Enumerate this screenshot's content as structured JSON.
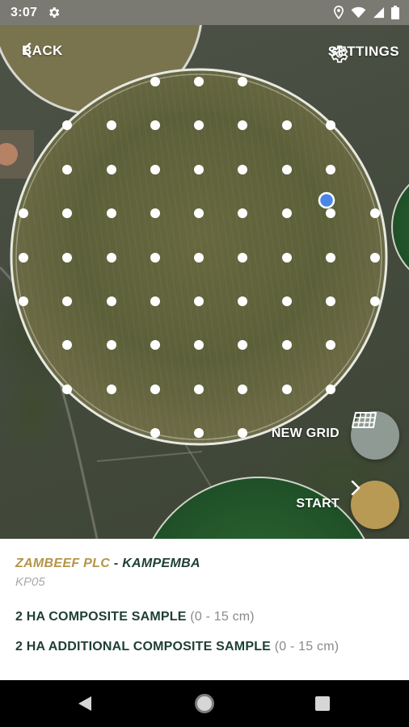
{
  "status_bar": {
    "time": "3:07",
    "icons": [
      "gear-icon",
      "location-icon",
      "wifi-icon",
      "signal-icon",
      "battery-icon"
    ]
  },
  "map": {
    "back_label": "BACK",
    "settings_label": "SETTINGS",
    "new_grid_label": "NEW GRID",
    "start_label": "START",
    "colors": {
      "grid_point": "#ffffff",
      "current_location": "#4a86e8",
      "start_button": "#b89a55",
      "new_grid_button": "#8e9a93"
    }
  },
  "info": {
    "farm_name": "ZAMBEEF PLC",
    "separator": " - ",
    "field_name": "KAMPEMBA",
    "field_code": "KP05",
    "samples": [
      {
        "label": "2 HA COMPOSITE SAMPLE",
        "depth": "(0 - 15 cm)"
      },
      {
        "label": "2 HA ADDITIONAL COMPOSITE SAMPLE",
        "depth": "(0 - 15 cm)"
      }
    ],
    "colors": {
      "farm": "#b49448",
      "field": "#1e3f35"
    }
  },
  "nav": {
    "icons": [
      "back-triangle-icon",
      "home-circle-icon",
      "recents-square-icon"
    ]
  }
}
